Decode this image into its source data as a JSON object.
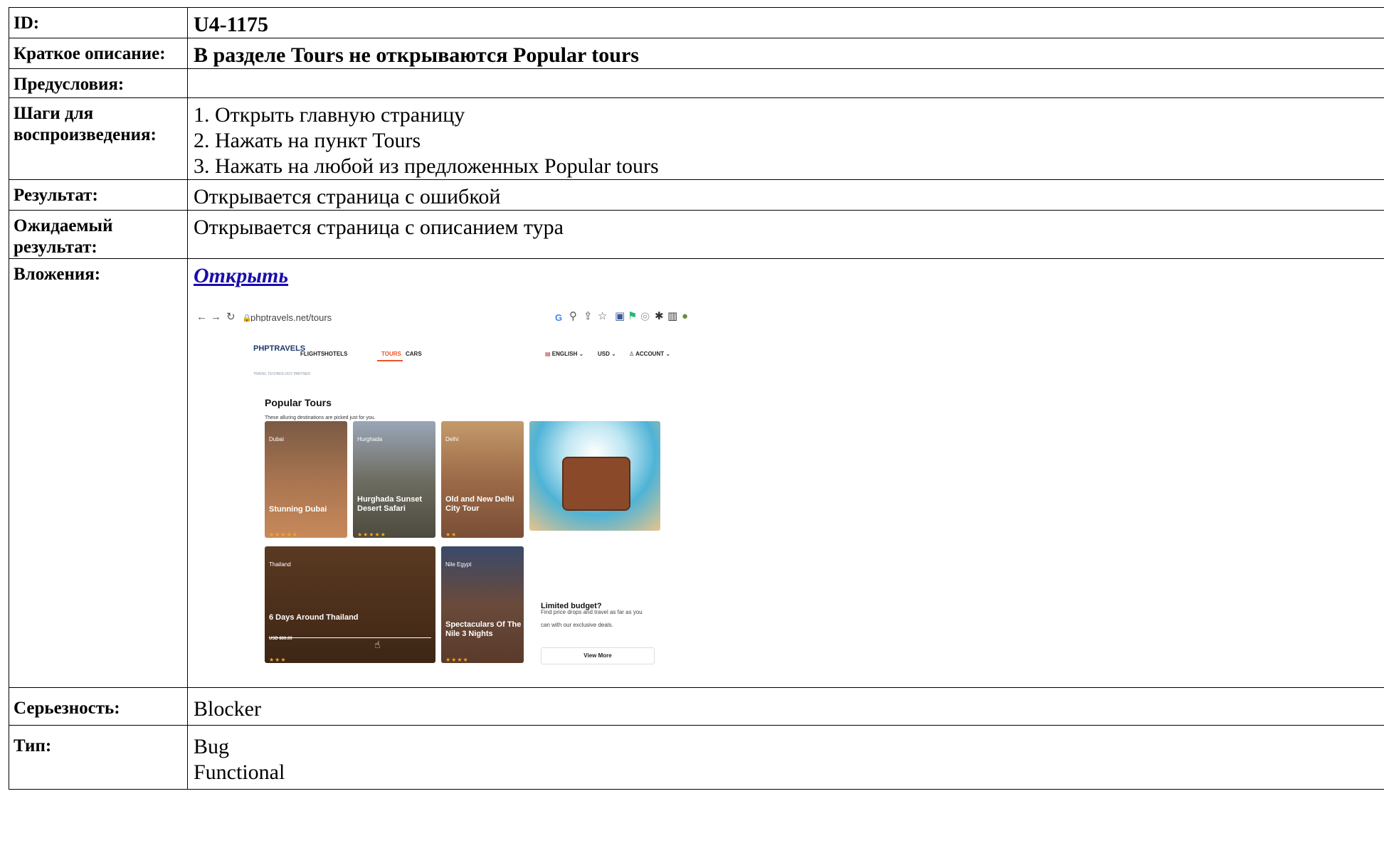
{
  "rows": {
    "id": {
      "label": "ID:",
      "value": "U4-1175"
    },
    "summary": {
      "label": "Краткое описание:",
      "value": "В разделе Tours не открываются Popular tours"
    },
    "preconditions": {
      "label": "Предусловия:",
      "value": ""
    },
    "steps": {
      "label": "Шаги для воспроизведения:",
      "items": [
        "1. Открыть главную страницу",
        "2. Нажать на пункт Tours",
        "3. Нажать на любой из предложенных Popular tours"
      ]
    },
    "result": {
      "label": "Результат:",
      "value": "Открывается страница с ошибкой"
    },
    "expected": {
      "label": "Ожидаемый результат:",
      "value": "Открывается страница с описанием тура"
    },
    "attachments": {
      "label": "Вложения:",
      "link": "Открыть"
    },
    "severity": {
      "label": "Серьезность:",
      "value": "Blocker"
    },
    "type": {
      "label": "Тип:",
      "items": [
        "Bug",
        "Functional"
      ]
    }
  },
  "screenshot": {
    "url": "phptravels.net/tours",
    "logo": "PHPTRAVELS",
    "logo_tagline": "TRAVEL TECHNOLOGY PARTNER",
    "nav": [
      "FLIGHTS",
      "HOTELS",
      "TOURS",
      "CARS"
    ],
    "active_nav": "TOURS",
    "language": "ENGLISH",
    "currency": "USD",
    "account": "ACCOUNT",
    "section_title": "Popular Tours",
    "section_subtitle": "These alluring destinations are picked just for you.",
    "cards": [
      {
        "location": "Dubai",
        "title": "Stunning Dubai",
        "stars": "★★★★★",
        "color_top": "#7a5a44",
        "color_bottom": "#c8895a"
      },
      {
        "location": "Hurghada",
        "title": "Hurghada Sunset Desert Safari",
        "stars": "★★★★★",
        "color_top": "#9aa6b8",
        "color_bottom": "#4d4a3e"
      },
      {
        "location": "Delhi",
        "title": "Old and New Delhi City Tour",
        "stars": "★★",
        "color_top": "#c49a6a",
        "color_bottom": "#7a4e36"
      },
      {
        "location": "Thailand",
        "title": "6 Days Around Thailand",
        "price": "USD 860.00",
        "stars": "★★★",
        "color_top": "#5a3a22",
        "color_bottom": "#3c2616"
      },
      {
        "location": "Nile Egypt",
        "title": "Spectaculars Of The Nile 3 Nights",
        "stars": "★★★★",
        "color_top": "#3a4a6a",
        "color_bottom": "#5a3a2a"
      }
    ],
    "budget_title": "Limited budget?",
    "budget_text": "Find price drops and travel as far as you can with our exclusive deals.",
    "view_more": "View More"
  }
}
